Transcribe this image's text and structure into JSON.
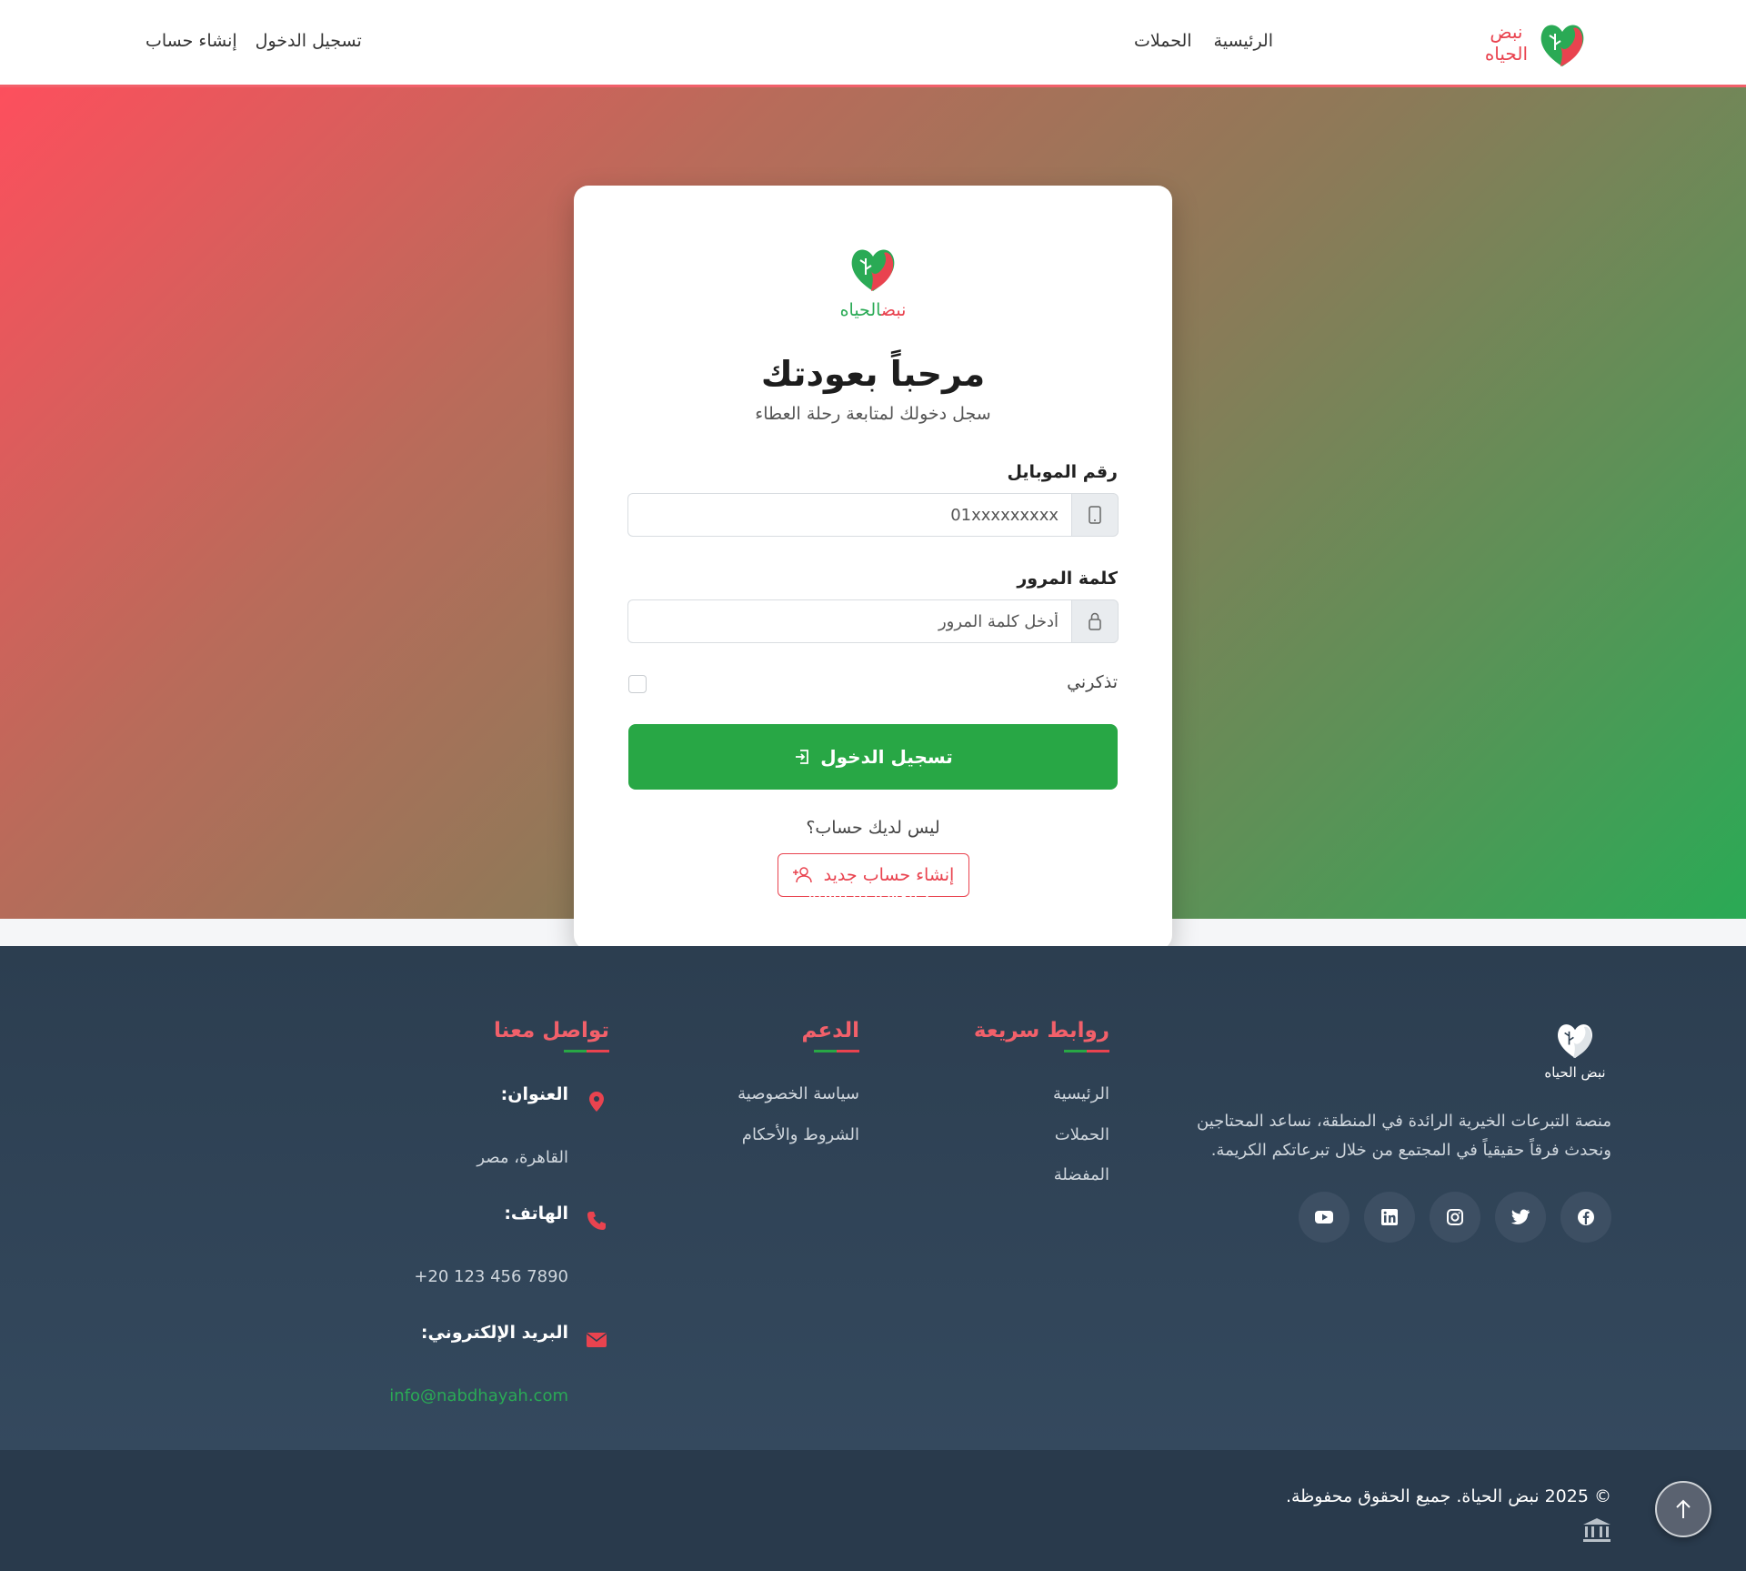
{
  "navbar": {
    "brand_line1": "نبض",
    "brand_line2": "الحياه",
    "links": [
      "الرئيسية",
      "الحملات"
    ],
    "auth": [
      "تسجيل الدخول",
      "إنشاء حساب"
    ]
  },
  "login_card": {
    "logo_part1": "نبض",
    "logo_part2": "الحياه",
    "title": "مرحباً بعودتك",
    "subtitle": "سجل دخولك لمتابعة رحلة العطاء",
    "phone_label": "رقم الموبايل",
    "phone_placeholder": "01xxxxxxxxx",
    "password_label": "كلمة المرور",
    "password_placeholder": "أدخل كلمة المرور",
    "remember_label": "تذكرني",
    "remember_checked": false,
    "login_button": "تسجيل الدخول",
    "no_account_text": "ليس لديك حساب؟",
    "register_button": "إنشاء حساب جديد"
  },
  "back_link": "← العودة للرئيسية",
  "footer": {
    "logo_text": "نبض الحياه",
    "description": "منصة التبرعات الخيرية الرائدة في المنطقة، نساعد المحتاجين ونحدث فرقاً حقيقياً في المجتمع من خلال تبرعاتكم الكريمة.",
    "socials": [
      "facebook-icon",
      "twitter-icon",
      "instagram-icon",
      "linkedin-icon",
      "youtube-icon"
    ],
    "quick_links_title": "روابط سريعة",
    "quick_links": [
      "الرئيسية",
      "الحملات",
      "المفضلة"
    ],
    "support_title": "الدعم",
    "support_links": [
      "سياسة الخصوصية",
      "الشروط والأحكام"
    ],
    "contact_title": "تواصل معنا",
    "address_label": "العنوان:",
    "address_value": "القاهرة، مصر",
    "phone_label": "الهاتف:",
    "phone_value": "+20 123 456 7890",
    "email_label": "البريد الإلكتروني:",
    "email_value": "info@nabdhayah.com",
    "copyright": "© 2025 نبض الحياة. جميع الحقوق محفوظة."
  },
  "colors": {
    "brand_red": "#e9434f",
    "brand_green": "#28a745",
    "footer_bg": "#2c3e50"
  }
}
